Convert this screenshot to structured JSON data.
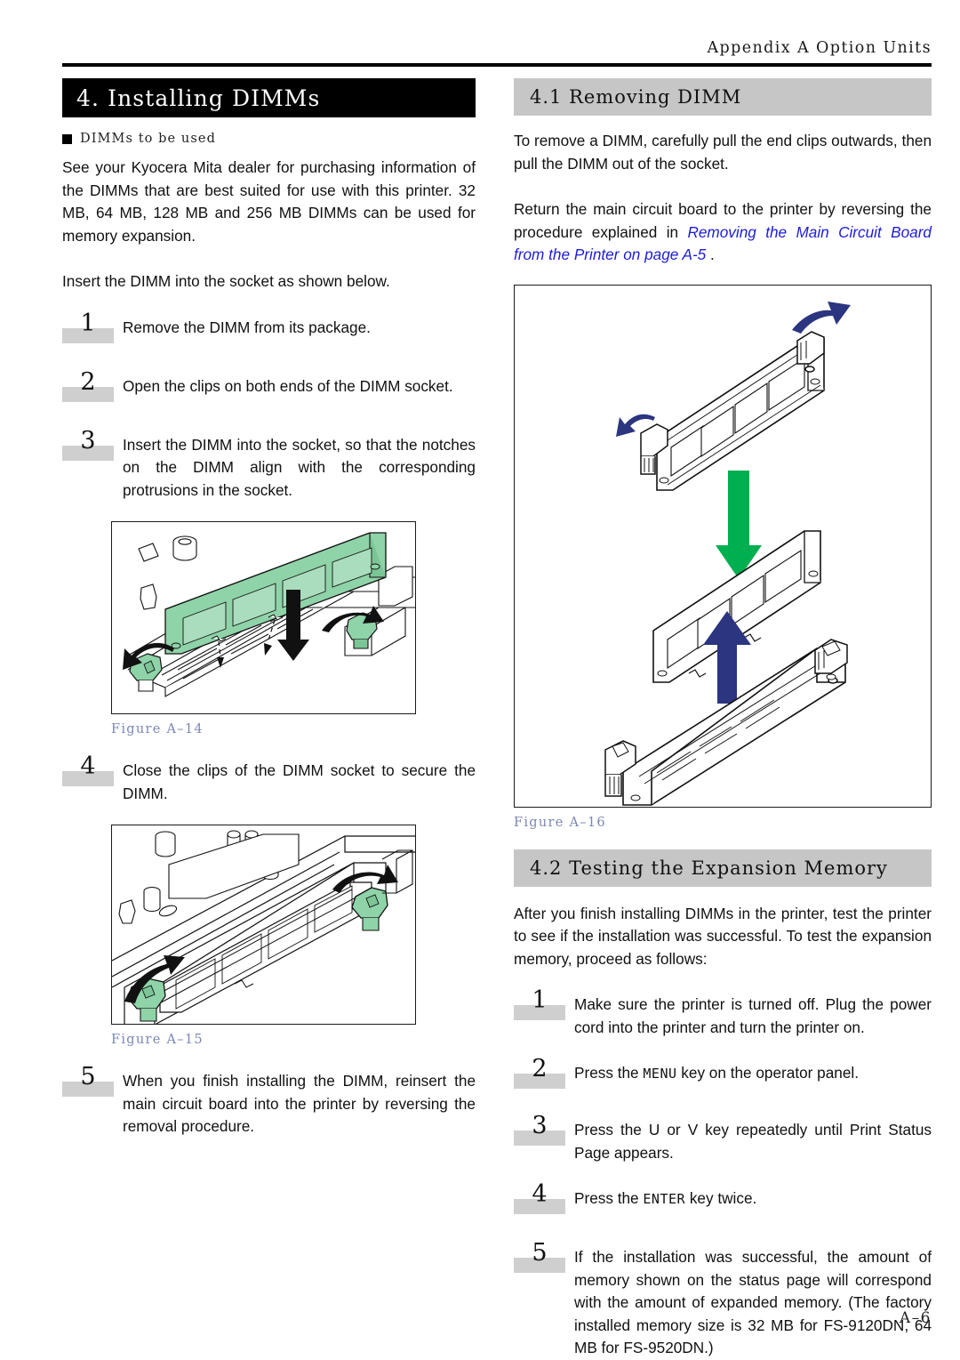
{
  "header": {
    "running_title": "Appendix A  Option Units"
  },
  "footer": {
    "page_number": "A–6"
  },
  "left_column": {
    "section_heading": "4. Installing DIMMs",
    "bullet_heading": "DIMMs to be used",
    "intro_paragraph": "See your Kyocera Mita dealer for purchasing information of the DIMMs that are best suited for use with this printer. 32 MB, 64 MB, 128 MB and 256 MB DIMMs can be used for memory expansion.",
    "insert_paragraph": "Insert the DIMM into the socket as shown below.",
    "steps": [
      {
        "number": "1",
        "text": "Remove the DIMM from its package."
      },
      {
        "number": "2",
        "text": "Open the clips on both ends of the DIMM socket."
      },
      {
        "number": "3",
        "text": "Insert the DIMM into the socket, so that the notches on the DIMM align with the corresponding protrusions in the socket."
      },
      {
        "number": "4",
        "text": "Close the clips of the DIMM socket to secure the DIMM."
      },
      {
        "number": "5",
        "text": "When you finish installing the DIMM, reinsert the main circuit board into the printer by reversing the removal procedure."
      }
    ],
    "figure_a14_caption": "Figure A–14",
    "figure_a15_caption": "Figure A–15"
  },
  "right_column": {
    "heading_41": "4.1 Removing DIMM",
    "para_remove": "To remove a DIMM, carefully pull the end clips outwards, then pull the DIMM out of the socket.",
    "para_return_prefix": "Return the main circuit board to the printer by reversing the procedure explained in ",
    "para_return_xref": "Removing the Main Circuit Board from the Printer on page A-5",
    "para_return_suffix": " .",
    "figure_a16_caption": "Figure A–16",
    "heading_42": "4.2 Testing the Expansion Memory",
    "para_testing": "After you finish installing DIMMs in the printer, test the printer to see if the installation was successful. To test the expansion memory, proceed as follows:",
    "steps": [
      {
        "number": "1",
        "text": "Make sure the printer is turned off. Plug the power cord into the printer and turn the printer on."
      },
      {
        "number": "2",
        "text_before": "Press the ",
        "key": "MENU",
        "text_after": " key on the operator panel."
      },
      {
        "number": "3",
        "text": "Press the  U  or  V  key repeatedly until  Print Status Page  appears."
      },
      {
        "number": "4",
        "text_before": "Press the ",
        "key": "ENTER",
        "text_after": " key twice."
      },
      {
        "number": "5",
        "text": "If the installation was successful, the amount of memory shown on the status page will correspond with the amount of expanded memory. (The factory installed memory size is 32 MB for FS-9120DN, 64 MB for FS-9520DN.)"
      }
    ]
  },
  "colors": {
    "heading_black_bg": "#000000",
    "heading_grey_bg": "#c6c6c6",
    "step_number_box": "#cfcfcf",
    "caption_blue": "#7b86b4",
    "xref_blue": "#1d1dd6",
    "dimm_green": "#8fd3a8",
    "arrow_navy": "#2b3580",
    "arrow_green": "#00b050"
  }
}
